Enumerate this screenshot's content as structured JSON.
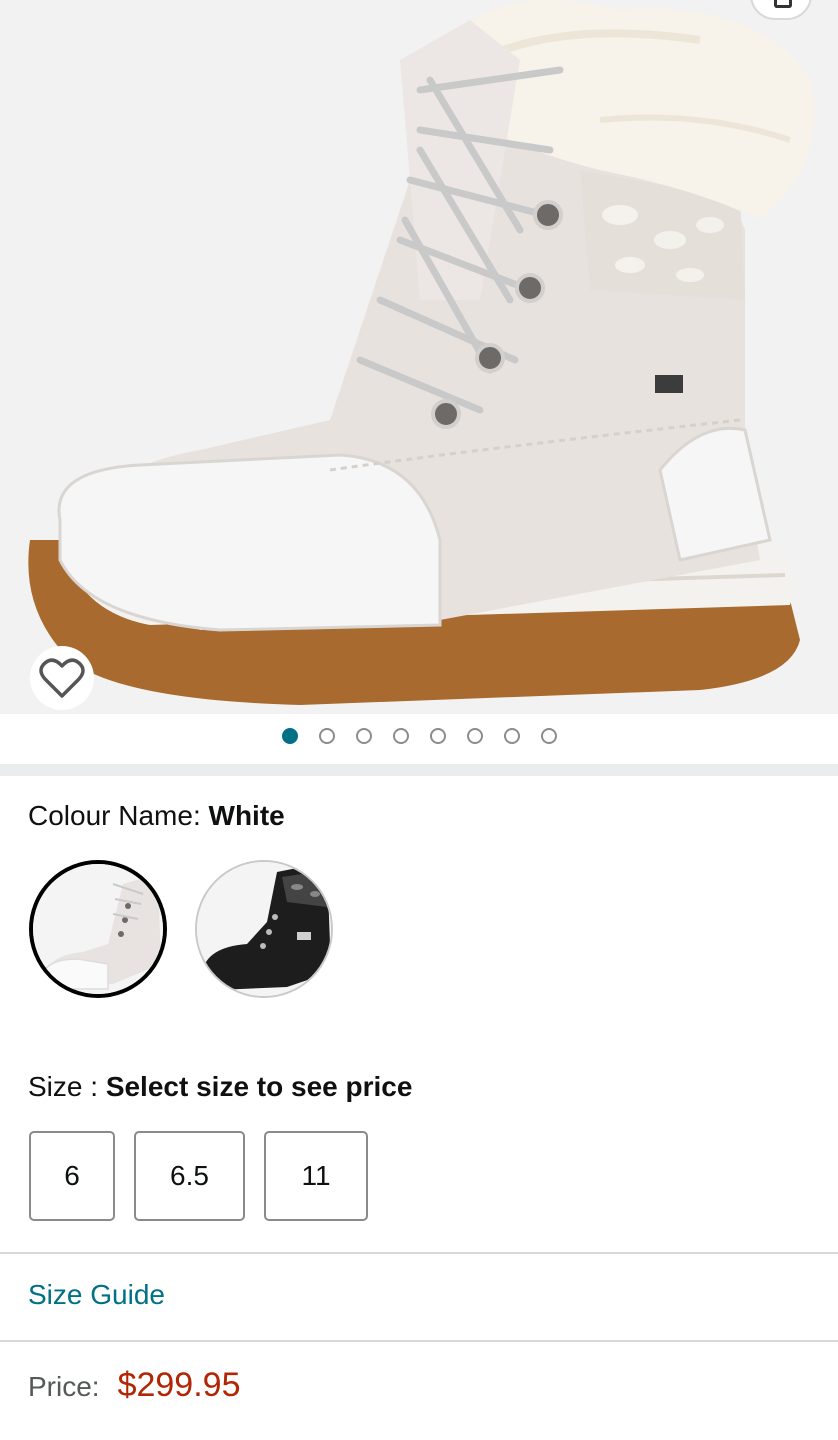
{
  "product": {
    "image_alt": "white lace-up winter boot with fur cuff",
    "image_count": 8,
    "active_image": 1
  },
  "colour": {
    "label": "Colour Name:",
    "value": "White",
    "options": [
      {
        "name": "White",
        "selected": true
      },
      {
        "name": "Black",
        "selected": false
      }
    ]
  },
  "size": {
    "label": "Size :",
    "prompt": "Select size to see price",
    "options": [
      "6",
      "6.5",
      "11"
    ]
  },
  "links": {
    "size_guide": "Size Guide"
  },
  "price": {
    "label": "Price:",
    "value": "$299.95"
  },
  "icons": {
    "wishlist": "heart-icon",
    "share": "share-icon"
  },
  "colors": {
    "accent": "#007185",
    "price": "#b12704"
  }
}
